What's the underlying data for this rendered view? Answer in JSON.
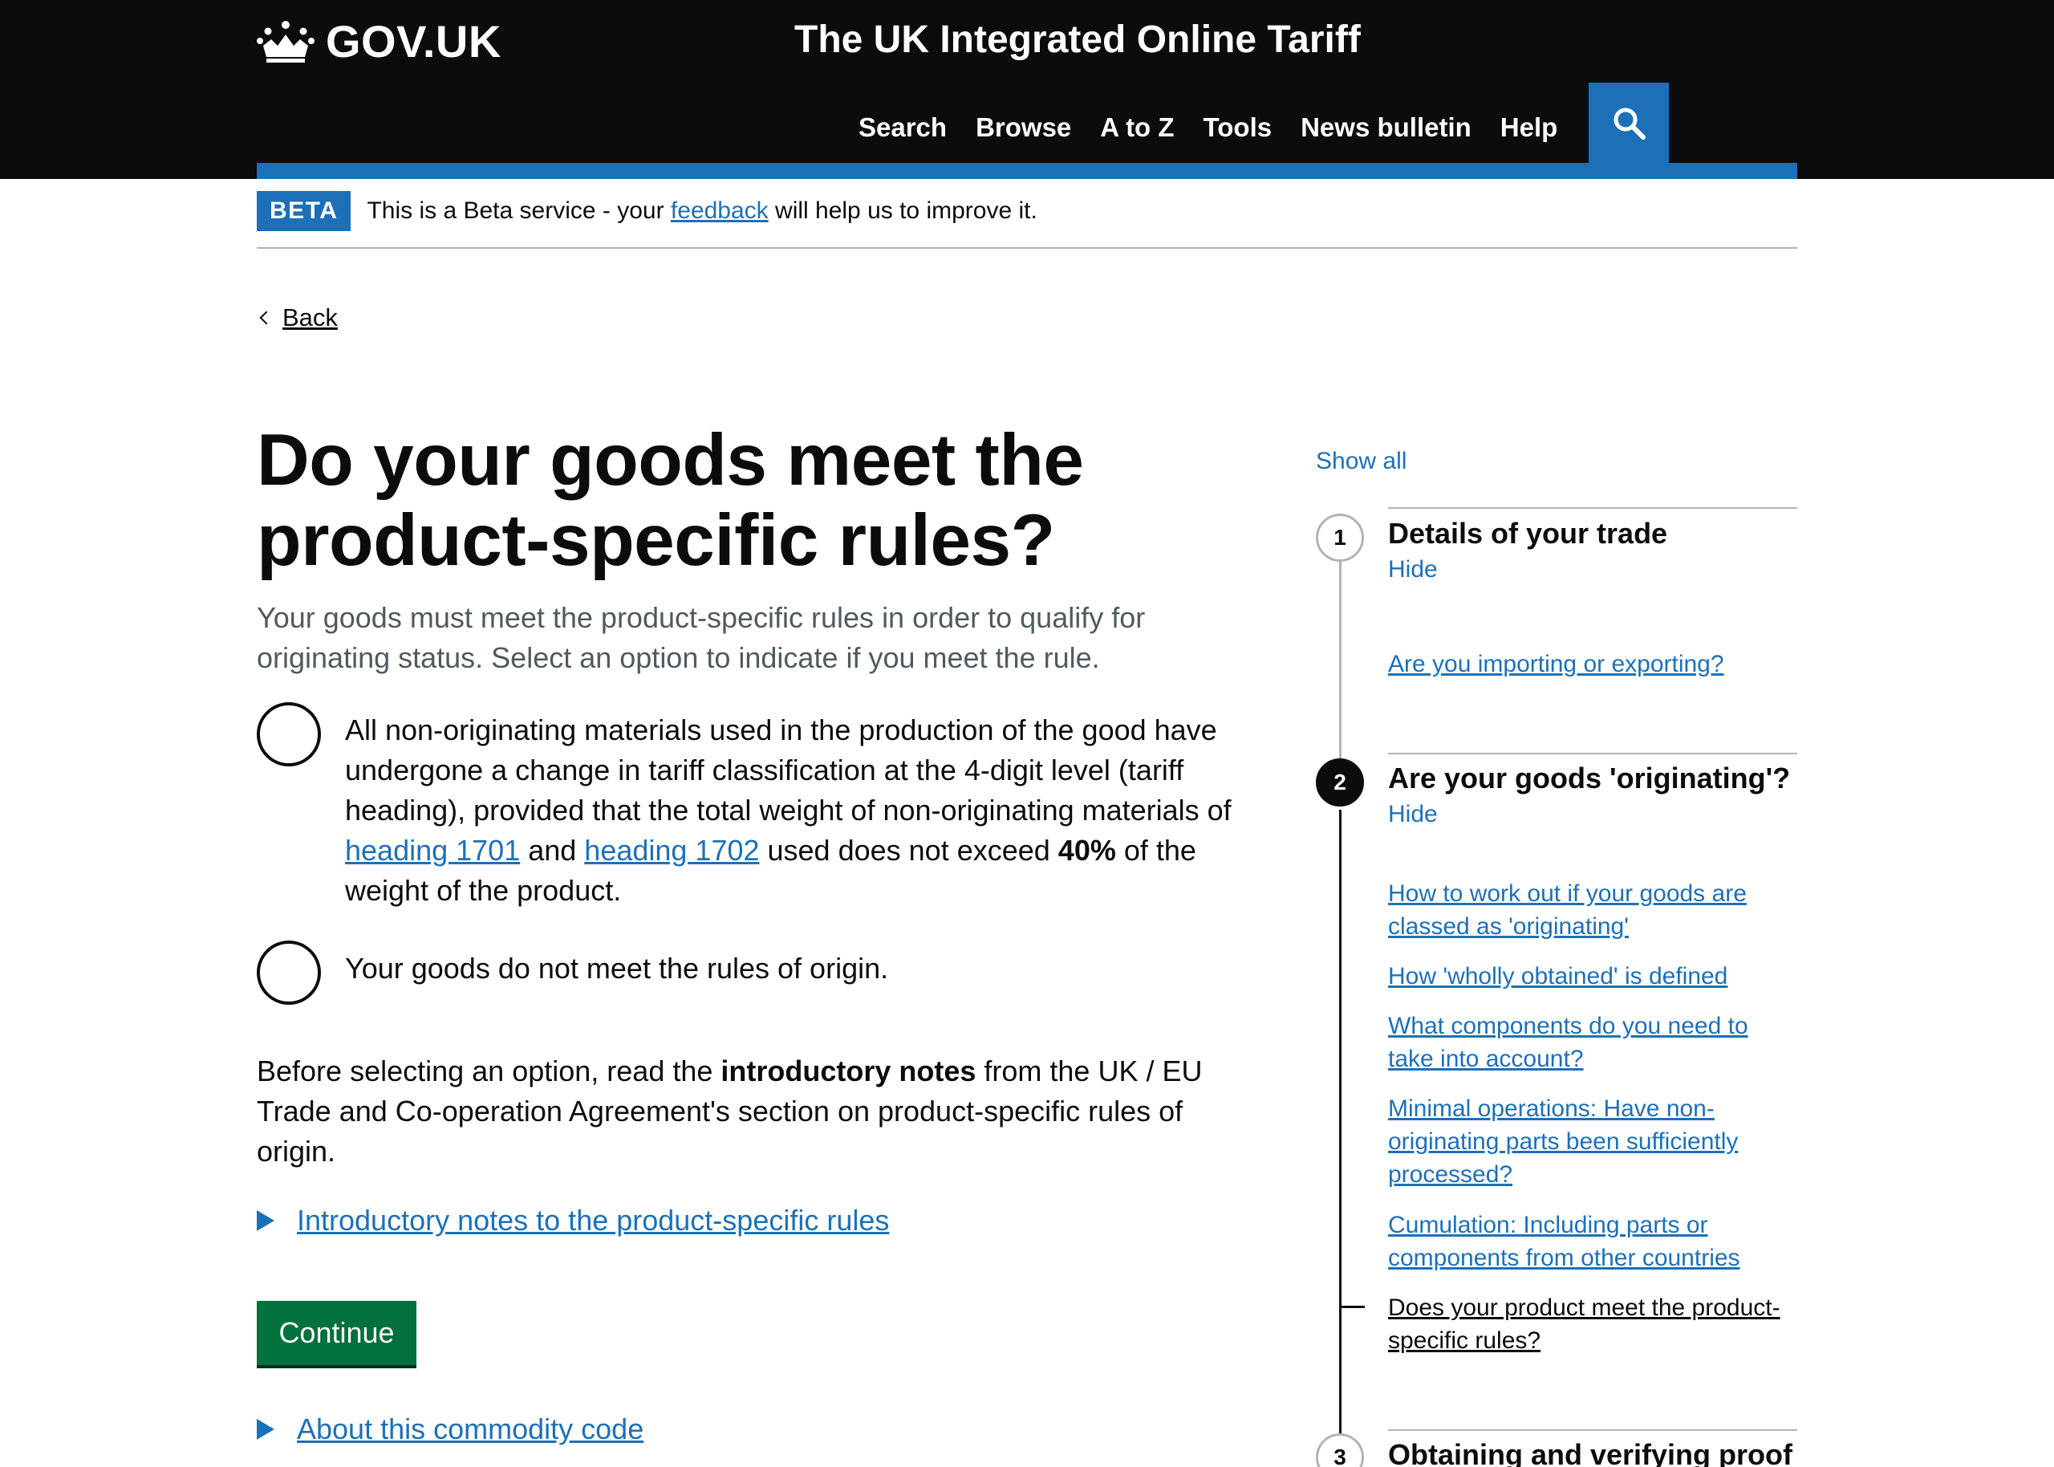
{
  "header": {
    "logo_text": "GOV.UK",
    "service_name": "The UK Integrated Online Tariff",
    "nav": [
      "Search",
      "Browse",
      "A to Z",
      "Tools",
      "News bulletin",
      "Help"
    ],
    "search_icon": "search-icon"
  },
  "beta": {
    "tag": "BETA",
    "text_before": "This is a Beta service - your ",
    "link": "feedback",
    "text_after": " will help us to improve it."
  },
  "back": {
    "label": "Back"
  },
  "main": {
    "title": "Do your goods meet the product-specific rules?",
    "lead": "Your goods must meet the product-specific rules in order to qualify for originating status. Select an option to indicate if you meet the rule.",
    "option1": {
      "text_a": "All non-originating materials used in the production of the good have undergone a change in tariff classification at the 4-digit level (tariff heading), provided that the total weight of non-originating materials of ",
      "link1": "heading 1701",
      "text_b": " and ",
      "link2": "heading 1702",
      "text_c": " used does not exceed ",
      "bold": "40%",
      "text_d": " of the weight of the product."
    },
    "option2": "Your goods do not meet the rules of origin.",
    "notes": {
      "before": "Before selecting an option, read the ",
      "bold": "introductory notes",
      "after": " from the UK / EU Trade and Co-operation Agreement's section on product-specific rules of origin."
    },
    "details1": "Introductory notes to the product-specific rules",
    "continue": "Continue",
    "details2": "About this commodity code"
  },
  "step_nav": {
    "show_all": "Show all",
    "steps": [
      {
        "number": "1",
        "title": "Details of your trade",
        "hide": "Hide",
        "links": [
          "Are you importing or exporting?"
        ]
      },
      {
        "number": "2",
        "title": "Are your goods 'originating'?",
        "hide": "Hide",
        "links": [
          "How to work out if your goods are classed as 'originating'",
          "How 'wholly obtained' is defined",
          "What components do you need to take into account?",
          "Minimal operations: Have non-originating parts been sufficiently processed?",
          "Cumulation: Including parts or components from other countries",
          "Does your product meet the product-specific rules?"
        ]
      },
      {
        "number": "3",
        "title": "Obtaining and verifying proof"
      }
    ]
  },
  "colors": {
    "header_bg": "#0b0c0c",
    "brand_blue": "#1d70b8",
    "button_green": "#00703c",
    "secondary_text": "#505a5f"
  }
}
